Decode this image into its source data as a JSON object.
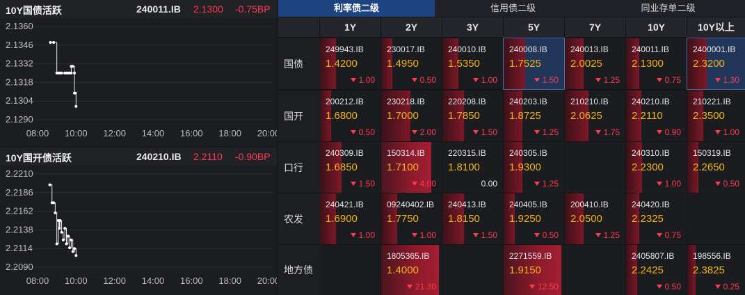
{
  "charts": [
    {
      "title": "10Y国债活跃",
      "code": "240011.IB",
      "price": "2.1300",
      "change": "-0.75BP",
      "chart_data": {
        "type": "line",
        "y_ticks": [
          "2.1360",
          "2.1346",
          "2.1332",
          "2.1318",
          "2.1304",
          "2.1290"
        ],
        "ylim": [
          2.129,
          2.136
        ],
        "x_ticks": [
          "08:00",
          "10:00",
          "12:00",
          "14:00",
          "16:00",
          "18:00",
          "20:00"
        ],
        "x": [
          "08:40",
          "08:50",
          "09:00",
          "09:05",
          "09:10",
          "09:15",
          "09:25",
          "09:30",
          "09:35",
          "09:40",
          "09:45",
          "09:45",
          "09:50",
          "09:55",
          "09:55",
          "09:58",
          "10:00"
        ],
        "values": [
          2.1348,
          2.1348,
          2.1325,
          2.1325,
          2.1325,
          2.1325,
          2.1325,
          2.1325,
          2.1325,
          2.1325,
          2.1325,
          2.133,
          2.133,
          2.1325,
          2.131,
          2.131,
          2.13
        ]
      }
    },
    {
      "title": "10Y国开债活跃",
      "code": "240210.IB",
      "price": "2.2110",
      "change": "-0.90BP",
      "chart_data": {
        "type": "line",
        "y_ticks": [
          "2.2210",
          "2.2186",
          "2.2162",
          "2.2138",
          "2.2114",
          "2.2090"
        ],
        "ylim": [
          2.209,
          2.221
        ],
        "x_ticks": [
          "08:00",
          "10:00",
          "12:00",
          "14:00",
          "16:00",
          "18:00",
          "20:00"
        ],
        "x": [
          "08:38",
          "08:45",
          "08:50",
          "08:55",
          "09:00",
          "09:05",
          "09:08",
          "09:10",
          "09:15",
          "09:20",
          "09:25",
          "09:30",
          "09:35",
          "09:40",
          "09:45",
          "09:50",
          "09:55",
          "10:00"
        ],
        "values": [
          2.2196,
          2.2173,
          2.2173,
          2.216,
          2.212,
          2.215,
          2.214,
          2.215,
          2.2135,
          2.2125,
          2.214,
          2.212,
          2.213,
          2.2115,
          2.2125,
          2.211,
          2.2114,
          2.2105
        ]
      }
    }
  ],
  "matrix": {
    "tabs": [
      "利率债二级",
      "信用债二级",
      "同业存单二级"
    ],
    "active_tab": 0,
    "columns": [
      "1Y",
      "2Y",
      "3Y",
      "5Y",
      "7Y",
      "10Y",
      "10Y以上"
    ],
    "rows": [
      {
        "label": "国债",
        "cells": [
          {
            "code": "249943.IB",
            "yield": "1.4200",
            "change": "1.00",
            "bar": 0.2
          },
          {
            "code": "230017.IB",
            "yield": "1.4950",
            "change": "0.50",
            "bar": 0.1
          },
          {
            "code": "240010.IB",
            "yield": "1.5350",
            "change": "1.00",
            "bar": 0.2
          },
          {
            "code": "240008.IB",
            "yield": "1.7525",
            "change": "1.50",
            "bar": 0.3,
            "highlight": true
          },
          {
            "code": "240013.IB",
            "yield": "2.0025",
            "change": "1.25",
            "bar": 0.25
          },
          {
            "code": "240011.IB",
            "yield": "2.1300",
            "change": "0.75",
            "bar": 0.15
          },
          {
            "code": "2400001.IB",
            "yield": "2.3200",
            "change": "1.30",
            "bar": 0.26,
            "highlight": true
          }
        ]
      },
      {
        "label": "国开",
        "cells": [
          {
            "code": "200212.IB",
            "yield": "1.6800",
            "change": "0.50",
            "bar": 0.1
          },
          {
            "code": "230218.IB",
            "yield": "1.7000",
            "change": "2.00",
            "bar": 0.45
          },
          {
            "code": "220208.IB",
            "yield": "1.7850",
            "change": "1.50",
            "bar": 0.3
          },
          {
            "code": "240203.IB",
            "yield": "1.8725",
            "change": "1.25",
            "bar": 0.25
          },
          {
            "code": "210210.IB",
            "yield": "2.0625",
            "change": "1.75",
            "bar": 0.35
          },
          {
            "code": "240210.IB",
            "yield": "2.2110",
            "change": "0.90",
            "bar": 0.18
          },
          {
            "code": "210221.IB",
            "yield": "2.3500",
            "change": "1.00",
            "bar": 0.2
          }
        ]
      },
      {
        "label": "口行",
        "cells": [
          {
            "code": "240309.IB",
            "yield": "1.6850",
            "change": "1.50",
            "bar": 0.3
          },
          {
            "code": "150314.IB",
            "yield": "1.7100",
            "change": "4.00",
            "bar": 0.85
          },
          {
            "code": "220315.IB",
            "yield": "1.8100",
            "change": "0.00",
            "bar": 0,
            "flat": true
          },
          {
            "code": "240305.IB",
            "yield": "1.9300",
            "change": "1.25",
            "bar": 0.25
          },
          null,
          {
            "code": "240310.IB",
            "yield": "2.2300",
            "change": "1.00",
            "bar": 0.2
          },
          {
            "code": "150319.IB",
            "yield": "2.2650",
            "change": "0.50",
            "bar": 0.1
          }
        ]
      },
      {
        "label": "农发",
        "cells": [
          {
            "code": "240421.IB",
            "yield": "1.6900",
            "change": "1.00",
            "bar": 0.2
          },
          {
            "code": "09240402.IB",
            "yield": "1.7750",
            "change": "1.00",
            "bar": 0.2
          },
          {
            "code": "240413.IB",
            "yield": "1.8150",
            "change": "1.50",
            "bar": 0.3
          },
          {
            "code": "240405.IB",
            "yield": "1.9250",
            "change": "0.50",
            "bar": 0.1
          },
          {
            "code": "200410.IB",
            "yield": "2.0500",
            "change": "1.25",
            "bar": 0.25
          },
          {
            "code": "240420.IB",
            "yield": "2.2325",
            "change": "0.75",
            "bar": 0.15
          },
          null
        ]
      },
      {
        "label": "地方债",
        "cells": [
          null,
          {
            "code": "1805365.IB",
            "yield": "1.4000",
            "change": "21.30",
            "bar": 1.0
          },
          null,
          {
            "code": "2271559.IB",
            "yield": "1.9150",
            "change": "12.50",
            "bar": 1.0
          },
          null,
          {
            "code": "2405807.IB",
            "yield": "2.2425",
            "change": "0.50",
            "bar": 0.1
          },
          {
            "code": "198556.IB",
            "yield": "2.3825",
            "change": "0.25",
            "bar": 0.05
          }
        ]
      }
    ]
  },
  "colors": {
    "up_red": "#ff3b50",
    "yield_orange": "#f2b21b",
    "tab_active": "#1d4380",
    "bar_red": "#8e1a2c"
  }
}
